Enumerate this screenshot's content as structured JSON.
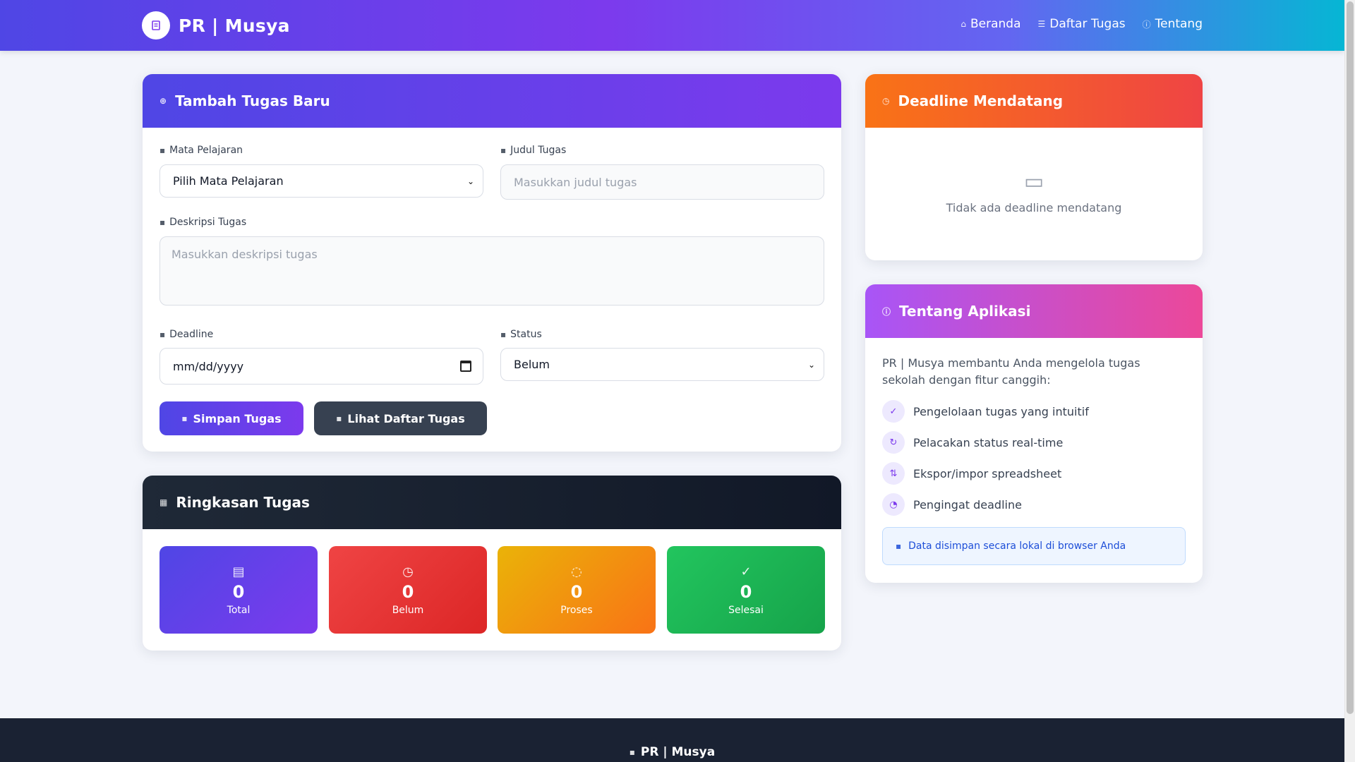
{
  "app": {
    "brand": "PR | Musya"
  },
  "nav": {
    "items": [
      {
        "label": "Beranda",
        "icon": "home-icon"
      },
      {
        "label": "Daftar Tugas",
        "icon": "list-icon"
      },
      {
        "label": "Tentang",
        "icon": "info-icon"
      }
    ]
  },
  "form": {
    "title": "Tambah Tugas Baru",
    "subject": {
      "label": "Mata Pelajaran",
      "value": "Pilih Mata Pelajaran"
    },
    "task_title": {
      "label": "Judul Tugas",
      "placeholder": "Masukkan judul tugas"
    },
    "description": {
      "label": "Deskripsi Tugas",
      "placeholder": "Masukkan deskripsi tugas"
    },
    "deadline": {
      "label": "Deadline",
      "value": "mm/dd/yyyy"
    },
    "status": {
      "label": "Status",
      "value": "Belum"
    },
    "save_button": "Simpan Tugas",
    "list_button": "Lihat Daftar Tugas"
  },
  "summary": {
    "title": "Ringkasan Tugas",
    "stats": [
      {
        "value": "0",
        "label": "Total",
        "color": "#5b45e6"
      },
      {
        "value": "0",
        "label": "Belum",
        "color": "#ef4444"
      },
      {
        "value": "0",
        "label": "Proses",
        "color": "#f59e0b"
      },
      {
        "value": "0",
        "label": "Selesai",
        "color": "#22c55e"
      }
    ]
  },
  "deadline_card": {
    "title": "Deadline Mendatang",
    "empty_text": "Tidak ada deadline mendatang"
  },
  "about": {
    "title": "Tentang Aplikasi",
    "description": "PR | Musya membantu Anda mengelola tugas sekolah dengan fitur canggih:",
    "features": [
      "Pengelolaan tugas yang intuitif",
      "Pelacakan status real-time",
      "Ekspor/impor spreadsheet",
      "Pengingat deadline"
    ],
    "info": "Data disimpan secara lokal di browser Anda"
  },
  "footer": {
    "brand": "PR | Musya"
  },
  "colors": {
    "primary": "#4f46e5",
    "accent": "#7c3aed",
    "dark": "#1f2937",
    "orange": "#f97316",
    "pink": "#ec4899"
  }
}
